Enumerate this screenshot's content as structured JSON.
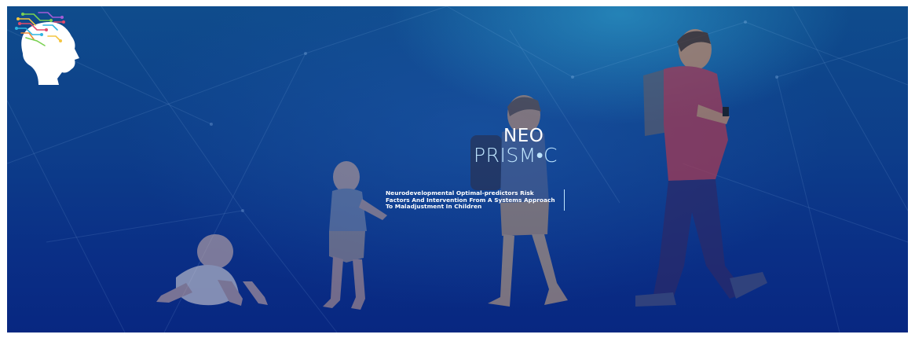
{
  "banner": {
    "logo": {
      "line1": "NEO",
      "line2": "PRISM•C",
      "tagline": "Neurodevelopmental Optimal-predictors Risk\nFactors And Intervention From A Systems Approach\nTo Maladjustment In Children"
    },
    "figures": [
      "baby-crawling",
      "toddler-walking",
      "child-with-backpack",
      "teen-with-phone"
    ],
    "colors": {
      "background_top": "#0f4c8c",
      "background_bottom": "#082781",
      "prism_text": "#bfe6ff"
    }
  }
}
